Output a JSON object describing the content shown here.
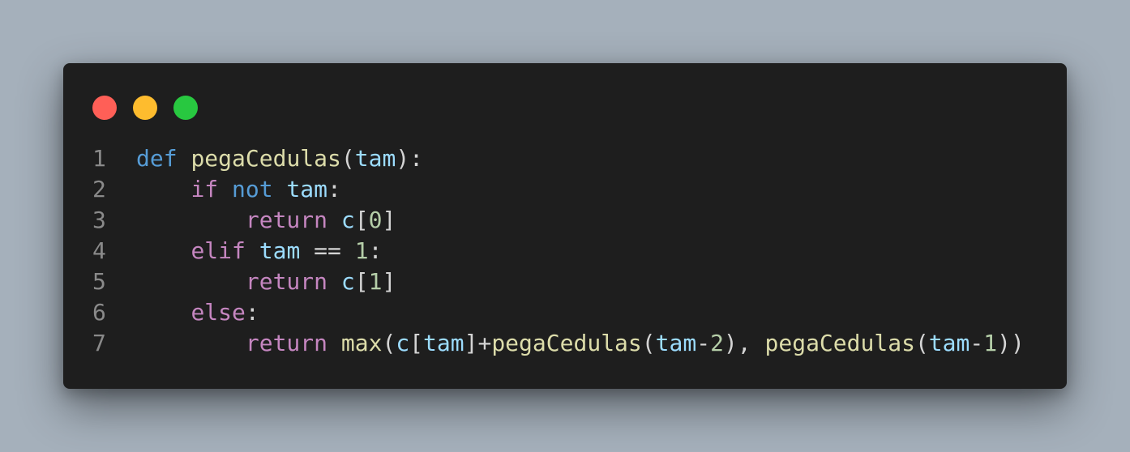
{
  "colors": {
    "background": "#a5b0bb",
    "window": "#1e1e1e",
    "dot_red": "#ff5f57",
    "dot_yellow": "#febc2e",
    "dot_green": "#28c840",
    "line_number": "#8a8a8a",
    "keyword_def": "#569cd6",
    "keyword_control": "#c586c0",
    "function": "#dcdcaa",
    "variable": "#9cdcfe",
    "number": "#b5cea8",
    "punctuation": "#d4d4d4"
  },
  "window_controls": [
    "close",
    "minimize",
    "maximize"
  ],
  "code": {
    "language": "python",
    "lines": [
      {
        "number": "1",
        "indent": "",
        "tokens": [
          {
            "t": "def",
            "k": "kw-def"
          },
          {
            "t": " ",
            "k": "pun"
          },
          {
            "t": "pegaCedulas",
            "k": "fn"
          },
          {
            "t": "(",
            "k": "pun"
          },
          {
            "t": "tam",
            "k": "var"
          },
          {
            "t": "):",
            "k": "pun"
          }
        ]
      },
      {
        "number": "2",
        "indent": "    ",
        "tokens": [
          {
            "t": "if",
            "k": "kw-ctrl"
          },
          {
            "t": " ",
            "k": "pun"
          },
          {
            "t": "not",
            "k": "kw-def"
          },
          {
            "t": " ",
            "k": "pun"
          },
          {
            "t": "tam",
            "k": "var"
          },
          {
            "t": ":",
            "k": "pun"
          }
        ]
      },
      {
        "number": "3",
        "indent": "        ",
        "tokens": [
          {
            "t": "return",
            "k": "kw-ctrl"
          },
          {
            "t": " ",
            "k": "pun"
          },
          {
            "t": "c",
            "k": "var"
          },
          {
            "t": "[",
            "k": "pun"
          },
          {
            "t": "0",
            "k": "num"
          },
          {
            "t": "]",
            "k": "pun"
          }
        ]
      },
      {
        "number": "4",
        "indent": "    ",
        "tokens": [
          {
            "t": "elif",
            "k": "kw-ctrl"
          },
          {
            "t": " ",
            "k": "pun"
          },
          {
            "t": "tam",
            "k": "var"
          },
          {
            "t": " == ",
            "k": "pun"
          },
          {
            "t": "1",
            "k": "num"
          },
          {
            "t": ":",
            "k": "pun"
          }
        ]
      },
      {
        "number": "5",
        "indent": "        ",
        "tokens": [
          {
            "t": "return",
            "k": "kw-ctrl"
          },
          {
            "t": " ",
            "k": "pun"
          },
          {
            "t": "c",
            "k": "var"
          },
          {
            "t": "[",
            "k": "pun"
          },
          {
            "t": "1",
            "k": "num"
          },
          {
            "t": "]",
            "k": "pun"
          }
        ]
      },
      {
        "number": "6",
        "indent": "    ",
        "tokens": [
          {
            "t": "else",
            "k": "kw-ctrl"
          },
          {
            "t": ":",
            "k": "pun"
          }
        ]
      },
      {
        "number": "7",
        "indent": "        ",
        "tokens": [
          {
            "t": "return",
            "k": "kw-ctrl"
          },
          {
            "t": " ",
            "k": "pun"
          },
          {
            "t": "max",
            "k": "fn"
          },
          {
            "t": "(",
            "k": "pun"
          },
          {
            "t": "c",
            "k": "var"
          },
          {
            "t": "[",
            "k": "pun"
          },
          {
            "t": "tam",
            "k": "var"
          },
          {
            "t": "]+",
            "k": "pun"
          },
          {
            "t": "pegaCedulas",
            "k": "fn"
          },
          {
            "t": "(",
            "k": "pun"
          },
          {
            "t": "tam",
            "k": "var"
          },
          {
            "t": "-",
            "k": "pun"
          },
          {
            "t": "2",
            "k": "num"
          },
          {
            "t": "), ",
            "k": "pun"
          },
          {
            "t": "pegaCedulas",
            "k": "fn"
          },
          {
            "t": "(",
            "k": "pun"
          },
          {
            "t": "tam",
            "k": "var"
          },
          {
            "t": "-",
            "k": "pun"
          },
          {
            "t": "1",
            "k": "num"
          },
          {
            "t": "))",
            "k": "pun"
          }
        ]
      }
    ]
  }
}
